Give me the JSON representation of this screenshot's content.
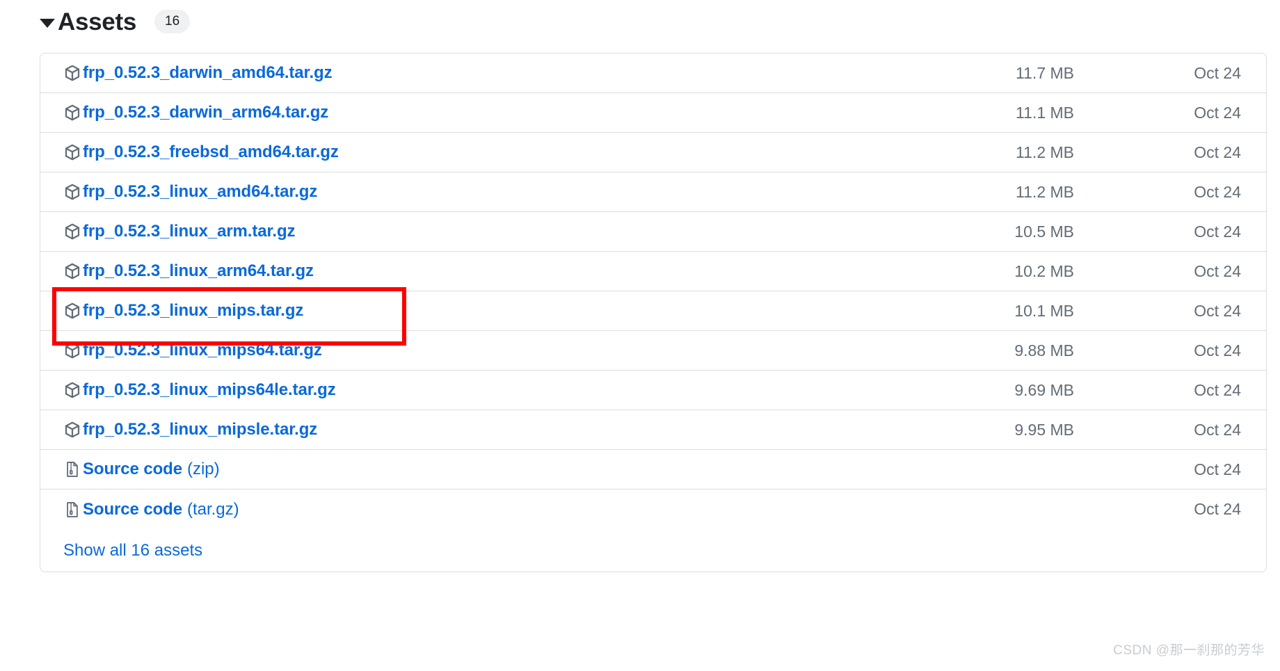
{
  "header": {
    "title": "Assets",
    "count": "16",
    "disclosure_icon": "triangle-down-icon"
  },
  "colors": {
    "link": "#0969da",
    "muted_text": "#636c76",
    "border": "#d8dee4",
    "badge_bg": "#eff1f3",
    "highlight": "#ff0000",
    "watermark": "#c9ccd1"
  },
  "assets": [
    {
      "icon": "package-icon",
      "name": "frp_0.52.3_darwin_amd64.tar.gz",
      "suffix": "",
      "size": "11.7 MB",
      "date": "Oct 24",
      "highlighted": false
    },
    {
      "icon": "package-icon",
      "name": "frp_0.52.3_darwin_arm64.tar.gz",
      "suffix": "",
      "size": "11.1 MB",
      "date": "Oct 24",
      "highlighted": false
    },
    {
      "icon": "package-icon",
      "name": "frp_0.52.3_freebsd_amd64.tar.gz",
      "suffix": "",
      "size": "11.2 MB",
      "date": "Oct 24",
      "highlighted": false
    },
    {
      "icon": "package-icon",
      "name": "frp_0.52.3_linux_amd64.tar.gz",
      "suffix": "",
      "size": "11.2 MB",
      "date": "Oct 24",
      "highlighted": false
    },
    {
      "icon": "package-icon",
      "name": "frp_0.52.3_linux_arm.tar.gz",
      "suffix": "",
      "size": "10.5 MB",
      "date": "Oct 24",
      "highlighted": false
    },
    {
      "icon": "package-icon",
      "name": "frp_0.52.3_linux_arm64.tar.gz",
      "suffix": "",
      "size": "10.2 MB",
      "date": "Oct 24",
      "highlighted": true
    },
    {
      "icon": "package-icon",
      "name": "frp_0.52.3_linux_mips.tar.gz",
      "suffix": "",
      "size": "10.1 MB",
      "date": "Oct 24",
      "highlighted": false
    },
    {
      "icon": "package-icon",
      "name": "frp_0.52.3_linux_mips64.tar.gz",
      "suffix": "",
      "size": "9.88 MB",
      "date": "Oct 24",
      "highlighted": false
    },
    {
      "icon": "package-icon",
      "name": "frp_0.52.3_linux_mips64le.tar.gz",
      "suffix": "",
      "size": "9.69 MB",
      "date": "Oct 24",
      "highlighted": false
    },
    {
      "icon": "package-icon",
      "name": "frp_0.52.3_linux_mipsle.tar.gz",
      "suffix": "",
      "size": "9.95 MB",
      "date": "Oct 24",
      "highlighted": false
    },
    {
      "icon": "file-zip-icon",
      "name": "Source code",
      "suffix": "(zip)",
      "size": "",
      "date": "Oct 24",
      "highlighted": false
    },
    {
      "icon": "file-zip-icon",
      "name": "Source code",
      "suffix": "(tar.gz)",
      "size": "",
      "date": "Oct 24",
      "highlighted": false
    }
  ],
  "footer": {
    "show_all_label": "Show all 16 assets"
  },
  "watermark": {
    "text": "CSDN @那一刹那的芳华"
  }
}
